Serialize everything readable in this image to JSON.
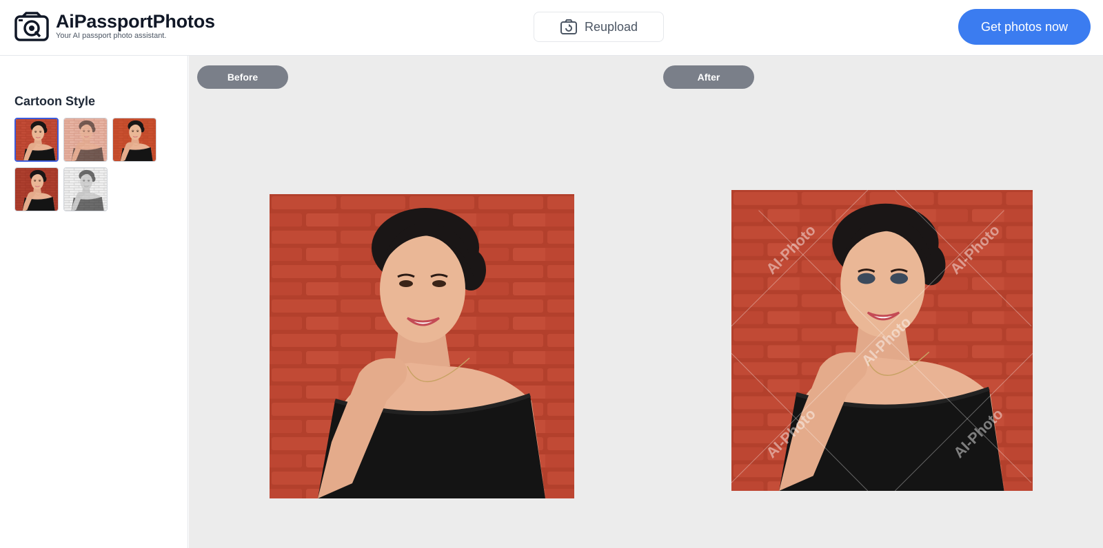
{
  "header": {
    "brand_title": "AiPassportPhotos",
    "brand_subtitle": "Your AI passport photo assistant.",
    "reupload_label": "Reupload",
    "cta_label": "Get photos now"
  },
  "sidebar": {
    "title": "Cartoon Style",
    "styles": [
      {
        "name": "cartoon-red",
        "selected": true
      },
      {
        "name": "cartoon-pastel",
        "selected": false
      },
      {
        "name": "cartoon-orange",
        "selected": false
      },
      {
        "name": "cartoon-dark-red",
        "selected": false
      },
      {
        "name": "cartoon-sketch",
        "selected": false
      }
    ]
  },
  "main": {
    "before_label": "Before",
    "after_label": "After",
    "watermark": "AI-Photo"
  },
  "colors": {
    "accent": "#3b7cf0",
    "pill": "#7a7f89",
    "canvas_bg": "#ececec",
    "brick": "#b8432f"
  }
}
